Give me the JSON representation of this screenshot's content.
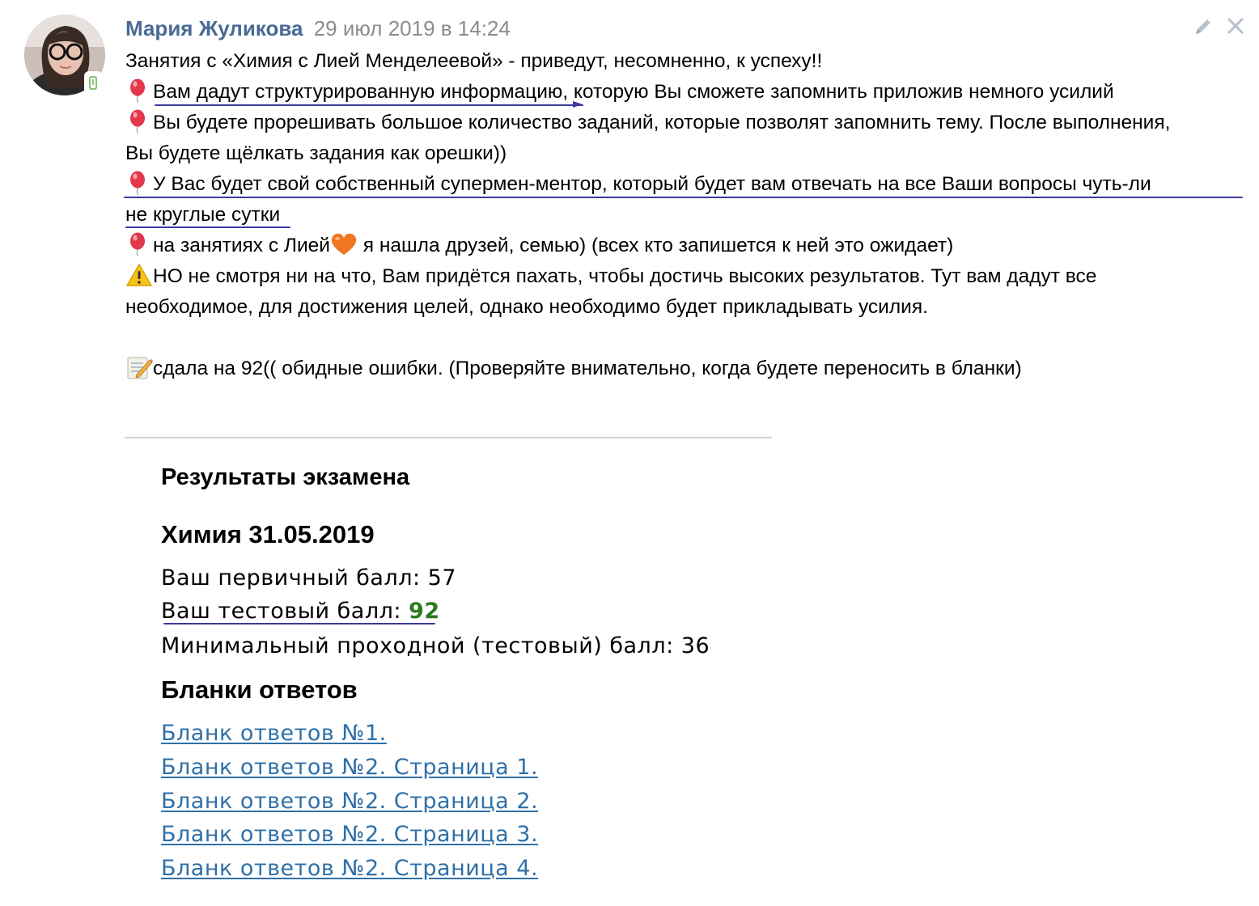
{
  "post": {
    "author": "Мария Жуликова",
    "date": "29 июл 2019 в 14:24",
    "lines": {
      "l1": "Занятия с «Химия с Лией Менделеевой» - приведут, несомненно, к успеху!!",
      "l2a": "Вам дадут структурированную информацию",
      "l2b": ", которую Вы сможете запомнить приложив немного усилий",
      "l3": "Вы будете прорешивать большое количество заданий, которые позволят запомнить тему. После выполнения,",
      "l4": "Вы будете щёлкать задания как орешки))",
      "l5": "У Вас будет свой собственный супермен-ментор, который будет вам отвечать на все Ваши вопросы чуть-ли",
      "l6": "не круглые сутки",
      "l7a": "на занятиях с Лией",
      "l7b": " я нашла друзей, семью) (всех кто запишется к ней это ожидает)",
      "l8": "НО не смотря ни на что, Вам придётся пахать, чтобы достичь высоких результатов. Тут вам дадут все",
      "l9": "необходимое, для достижения целей, однако необходимо будет прикладывать усилия.",
      "l10": "сдала на 92(( обидные ошибки. (Проверяйте внимательно, когда будете переносить в бланки)"
    },
    "icons": {
      "balloon": "balloon-icon",
      "heart": "orange-heart-icon",
      "warning": "warning-icon",
      "memo": "memo-icon"
    }
  },
  "results": {
    "title": "Результаты экзамена",
    "subject": "Химия 31.05.2019",
    "primary_label": "Ваш первичный балл: ",
    "primary_value": "57",
    "test_label": "Ваш тестовый балл: ",
    "test_value": "92",
    "min_label": "Минимальный проходной (тестовый) балл: ",
    "min_value": "36",
    "forms_title": "Бланки ответов",
    "links": [
      "Бланк ответов №1.",
      "Бланк ответов №2. Страница 1.",
      "Бланк ответов №2. Страница 2.",
      "Бланк ответов №2. Страница 3.",
      "Бланк ответов №2. Страница 4."
    ]
  },
  "colors": {
    "author": "#4a6a95",
    "date": "#8c8c8c",
    "link": "#2f70a8",
    "score": "#2c7a1e",
    "pen_annotation": "#3a3a9e"
  }
}
